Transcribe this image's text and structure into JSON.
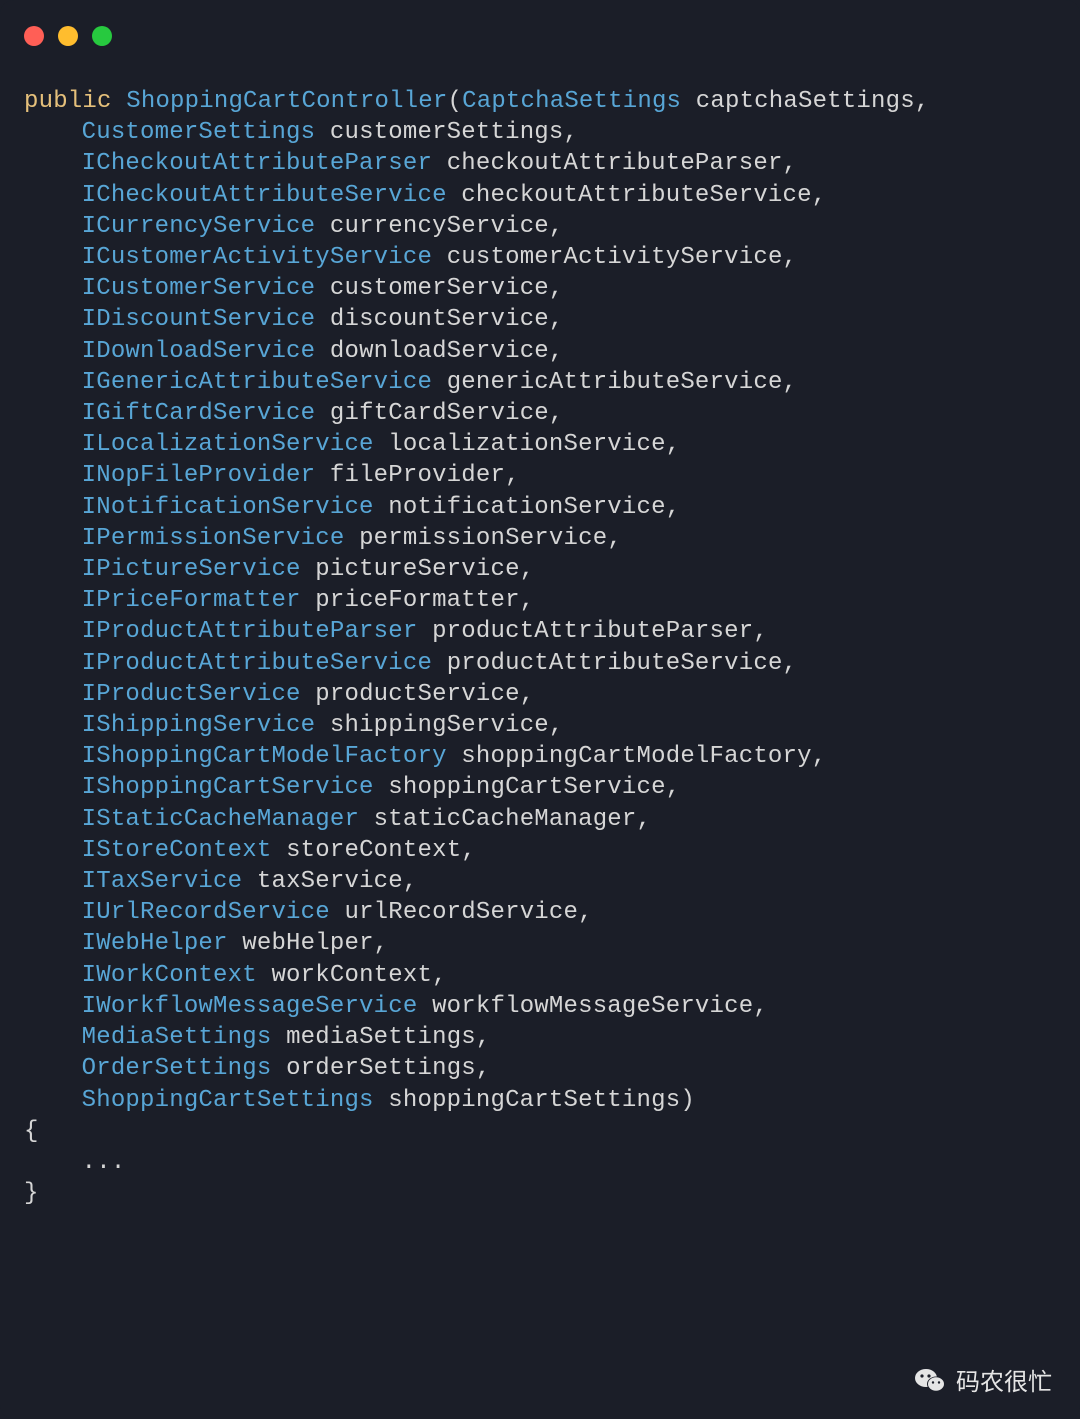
{
  "code": {
    "keyword_public": "public",
    "method_name": "ShoppingCartController",
    "open_paren": "(",
    "close_paren": ")",
    "brace_open": "{",
    "body_ellipsis": "...",
    "brace_close": "}",
    "first_param": {
      "type": "CaptchaSettings",
      "name": "captchaSettings"
    },
    "params": [
      {
        "type": "CustomerSettings",
        "name": "customerSettings"
      },
      {
        "type": "ICheckoutAttributeParser",
        "name": "checkoutAttributeParser"
      },
      {
        "type": "ICheckoutAttributeService",
        "name": "checkoutAttributeService"
      },
      {
        "type": "ICurrencyService",
        "name": "currencyService"
      },
      {
        "type": "ICustomerActivityService",
        "name": "customerActivityService"
      },
      {
        "type": "ICustomerService",
        "name": "customerService"
      },
      {
        "type": "IDiscountService",
        "name": "discountService"
      },
      {
        "type": "IDownloadService",
        "name": "downloadService"
      },
      {
        "type": "IGenericAttributeService",
        "name": "genericAttributeService"
      },
      {
        "type": "IGiftCardService",
        "name": "giftCardService"
      },
      {
        "type": "ILocalizationService",
        "name": "localizationService"
      },
      {
        "type": "INopFileProvider",
        "name": "fileProvider"
      },
      {
        "type": "INotificationService",
        "name": "notificationService"
      },
      {
        "type": "IPermissionService",
        "name": "permissionService"
      },
      {
        "type": "IPictureService",
        "name": "pictureService"
      },
      {
        "type": "IPriceFormatter",
        "name": "priceFormatter"
      },
      {
        "type": "IProductAttributeParser",
        "name": "productAttributeParser"
      },
      {
        "type": "IProductAttributeService",
        "name": "productAttributeService"
      },
      {
        "type": "IProductService",
        "name": "productService"
      },
      {
        "type": "IShippingService",
        "name": "shippingService"
      },
      {
        "type": "IShoppingCartModelFactory",
        "name": "shoppingCartModelFactory"
      },
      {
        "type": "IShoppingCartService",
        "name": "shoppingCartService"
      },
      {
        "type": "IStaticCacheManager",
        "name": "staticCacheManager"
      },
      {
        "type": "IStoreContext",
        "name": "storeContext"
      },
      {
        "type": "ITaxService",
        "name": "taxService"
      },
      {
        "type": "IUrlRecordService",
        "name": "urlRecordService"
      },
      {
        "type": "IWebHelper",
        "name": "webHelper"
      },
      {
        "type": "IWorkContext",
        "name": "workContext"
      },
      {
        "type": "IWorkflowMessageService",
        "name": "workflowMessageService"
      },
      {
        "type": "MediaSettings",
        "name": "mediaSettings"
      },
      {
        "type": "OrderSettings",
        "name": "orderSettings"
      },
      {
        "type": "ShoppingCartSettings",
        "name": "shoppingCartSettings"
      }
    ]
  },
  "watermark": {
    "text": "码农很忙"
  },
  "colors": {
    "background": "#1b1e28",
    "keyword": "#e5c07b",
    "type": "#58a6d6",
    "identifier": "#d6d6d6",
    "traffic_red": "#ff5f56",
    "traffic_yellow": "#ffbd2e",
    "traffic_green": "#27c93f"
  }
}
